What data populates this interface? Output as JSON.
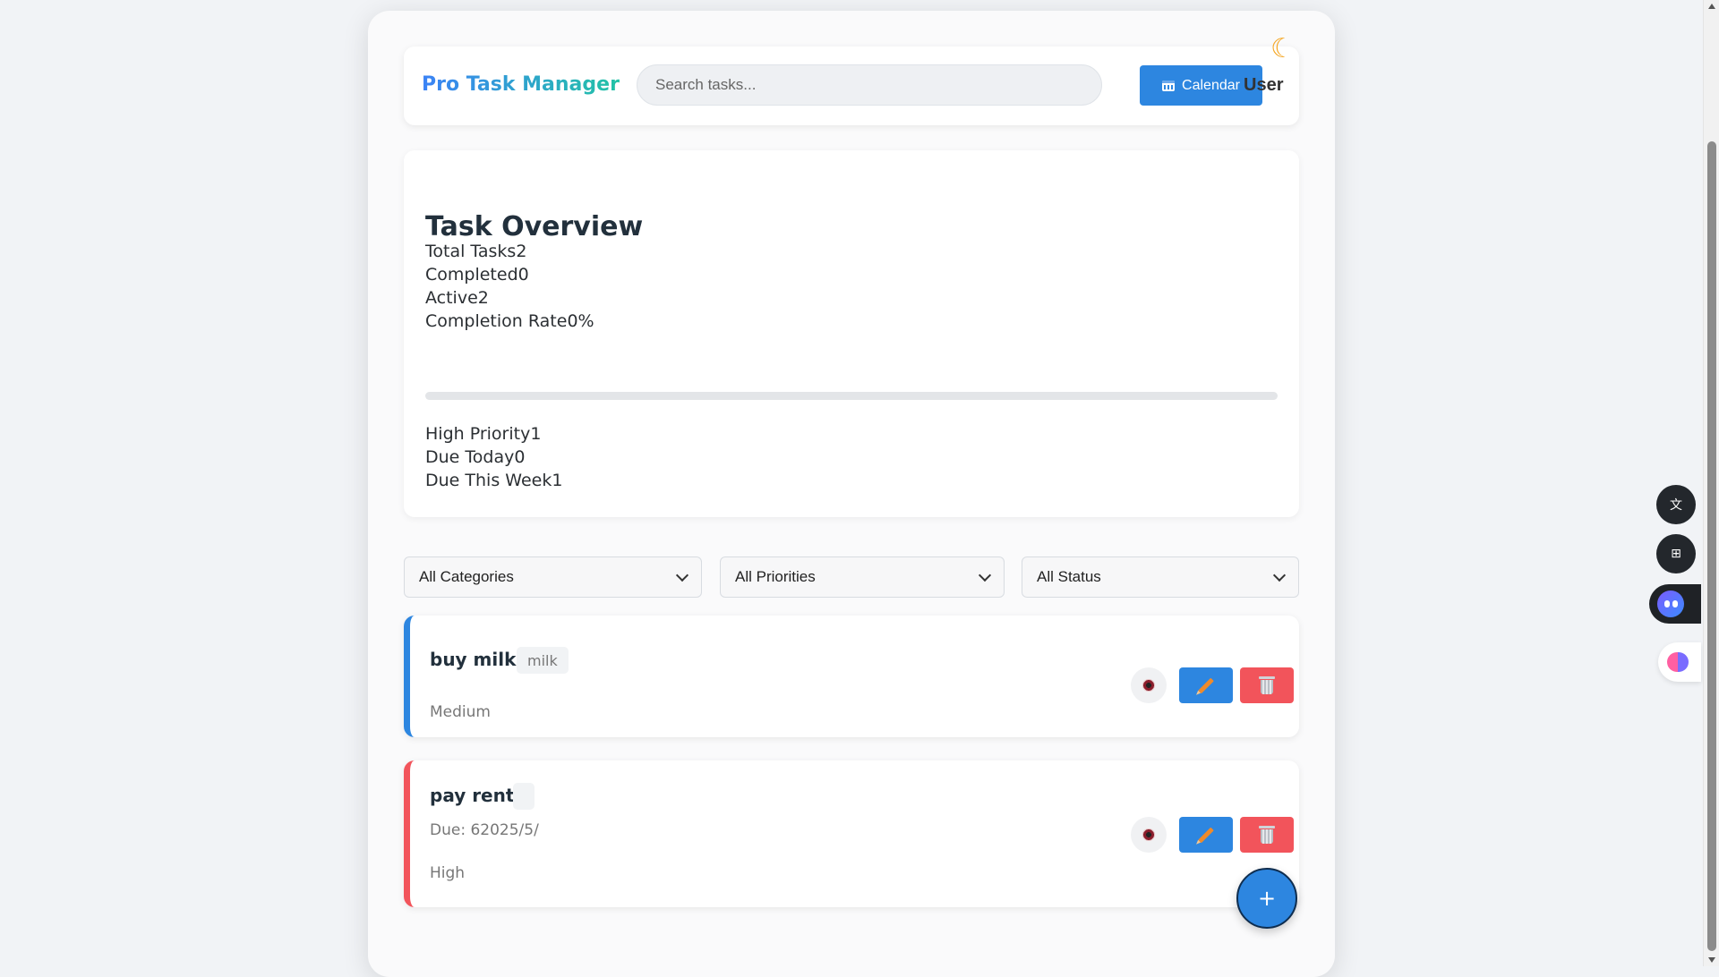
{
  "header": {
    "brand": "Pro Task Manager",
    "search_placeholder": "Search tasks...",
    "calendar_label": "Calendar",
    "user_label": "User",
    "theme_icon": "moon-icon"
  },
  "overview": {
    "title": "Task Overview",
    "stats": [
      {
        "label": "Total Tasks",
        "value": "2"
      },
      {
        "label": "Completed",
        "value": "0"
      },
      {
        "label": "Active",
        "value": "2"
      },
      {
        "label": "Completion Rate",
        "value": "0%"
      }
    ],
    "completion_progress": 0,
    "stats2": [
      {
        "label": "High Priority",
        "value": "1"
      },
      {
        "label": "Due Today",
        "value": "0"
      },
      {
        "label": "Due This Week",
        "value": "1"
      }
    ]
  },
  "filters": {
    "category": "All Categories",
    "priority": "All Priorities",
    "status": "All Status"
  },
  "tasks": [
    {
      "title": "buy milk",
      "tag": "milk",
      "due": "",
      "priority": "Medium"
    },
    {
      "title": "pay rent",
      "tag": "",
      "due": "Due: 62025/5/",
      "priority": "High"
    }
  ],
  "fab_label": "+",
  "colors": {
    "accent": "#2d86e0",
    "danger": "#f2545b",
    "brand_gradient_start": "#3b82f6",
    "brand_gradient_end": "#22c3a6"
  }
}
